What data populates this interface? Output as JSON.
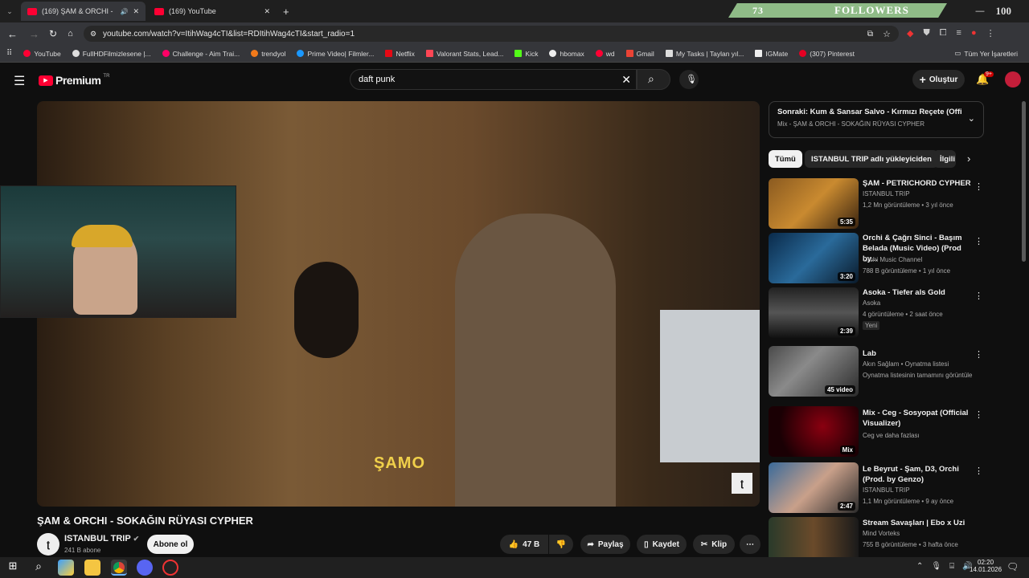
{
  "browser": {
    "tabs": [
      {
        "title": "(169) ŞAM & ORCHI - SOK...",
        "active": true
      },
      {
        "title": "(169) YouTube",
        "active": false
      }
    ],
    "new_tab": "+",
    "url": "youtube.com/watch?v=ItihWag4cTI&list=RDItihWag4cTI&start_radio=1",
    "bookmarks": [
      "YouTube",
      "FullHDFilmizlesene |...",
      "Challenge - Aim Trai...",
      "trendyol",
      "Prime Video| Filmler...",
      "Netflix",
      "Valorant Stats, Lead...",
      "Kick",
      "hbomax",
      "wd",
      "Gmail",
      "My Tasks | Taylan yıl...",
      "IGMate",
      "(307) Pinterest"
    ],
    "all_bookmarks": "Tüm Yer İşaretleri",
    "window_controls": {
      "minimize": "—"
    }
  },
  "overlay": {
    "count": "73",
    "label": "FOLLOWERS",
    "goal": "100"
  },
  "youtube": {
    "logo_text": "Premium",
    "logo_badge": "TR",
    "search_value": "daft punk",
    "create_label": "Oluştur",
    "notif_count": "9+"
  },
  "video": {
    "subtitle": "ŞAMO",
    "title": "ŞAM & ORCHI - SOKAĞIN RÜYASI CYPHER",
    "channel": "ISTANBUL TRIP",
    "subscribers": "241 B abone",
    "subscribe_label": "Abone ol",
    "likes": "47 B",
    "share_label": "Paylaş",
    "save_label": "Kaydet",
    "clip_label": "Klip"
  },
  "sidebar": {
    "up_next_title": "Sonraki: Kum & Sansar Salvo - Kırmızı Reçete (Offic...",
    "up_next_sub": "Mix - ŞAM & ORCHI - SOKAĞIN RÜYASI CYPHER",
    "chips": [
      "Tümü",
      "ISTANBUL TRIP adlı yükleyiciden",
      "İlgili"
    ],
    "videos": [
      {
        "title": "ŞAM - PETRICHORD CYPHER",
        "channel": "ISTANBUL TRIP",
        "meta": "1,2 Mn görüntüleme • 3 yıl önce",
        "duration": "5:35",
        "badge": ""
      },
      {
        "title": "Orchi & Çağrı Sinci - Başım Belada (Music Video) (Prod by...",
        "channel": "Orchi Music Channel",
        "meta": "788 B görüntüleme • 1 yıl önce",
        "duration": "3:20",
        "badge": ""
      },
      {
        "title": "Asoka - Tiefer als Gold",
        "channel": "Asoka",
        "meta": "4 görüntüleme • 2 saat önce",
        "duration": "2:39",
        "badge": "Yeni"
      },
      {
        "title": "Lab",
        "channel": "Akın Sağlam • Oynatma listesi",
        "meta": "Oynatma listesinin tamamını görüntüle",
        "duration": "45 video",
        "badge": ""
      },
      {
        "title": "Mix - Ceg - Sosyopat (Official Visualizer)",
        "channel": "Ceg ve daha fazlası",
        "meta": "",
        "duration": "Mix",
        "badge": ""
      },
      {
        "title": "Le Beyrut - Şam, D3, Orchi (Prod. by Genzo)",
        "channel": "ISTANBUL TRIP",
        "meta": "1,1 Mn görüntüleme • 9 ay önce",
        "duration": "2:47",
        "badge": ""
      },
      {
        "title": "Stream Savaşları | Ebo x Uzi",
        "channel": "Mind Vorteks",
        "meta": "755 B görüntüleme • 3 hafta önce",
        "duration": "",
        "badge": ""
      }
    ]
  },
  "taskbar": {
    "time": "02:20",
    "date": "14.01.2026"
  },
  "colors": {
    "yt_red": "#ff0033",
    "followers_green": "#8fbb87",
    "subtitle_yellow": "#f0d04a"
  }
}
